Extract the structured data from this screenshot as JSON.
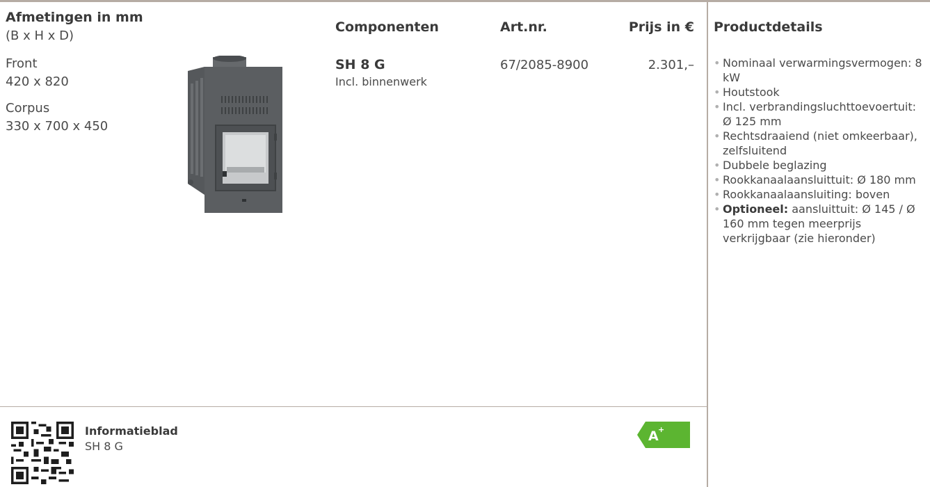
{
  "header": {
    "dimensions_title": "Afmetingen in mm",
    "dimensions_sub": "(B x H x D)",
    "components": "Componenten",
    "artnr": "Art.nr.",
    "price": "Prijs in €",
    "details": "Productdetails"
  },
  "dimensions": {
    "front_label": "Front",
    "front_value": "420 x 820",
    "corpus_label": "Corpus",
    "corpus_value": "330 x 700 x 450"
  },
  "product": {
    "name": "SH 8 G",
    "sub": "Incl. binnenwerk",
    "artnr": "67/2085-8900",
    "price": "2.301,–"
  },
  "details": [
    "Nominaal verwarmingsvermogen: 8 kW",
    "Houtstook",
    "Incl. verbrandingsluchttoevoertuit: Ø 125 mm",
    "Rechtsdraaiend (niet omkeerbaar), zelfsluitend",
    "Dubbele beglazing",
    "Rookkanaalaansluittuit: Ø 180 mm",
    "Rookkanaalaansluiting: boven"
  ],
  "optional": {
    "label": "Optioneel:",
    "text": " aansluittuit: Ø 145 / Ø 160 mm tegen meerprijs verkrijgbaar (zie hieronder)"
  },
  "info": {
    "title": "Informatieblad",
    "sub": "SH 8 G"
  },
  "energy": {
    "label": "A",
    "sup": "+",
    "color": "#5cb531"
  }
}
